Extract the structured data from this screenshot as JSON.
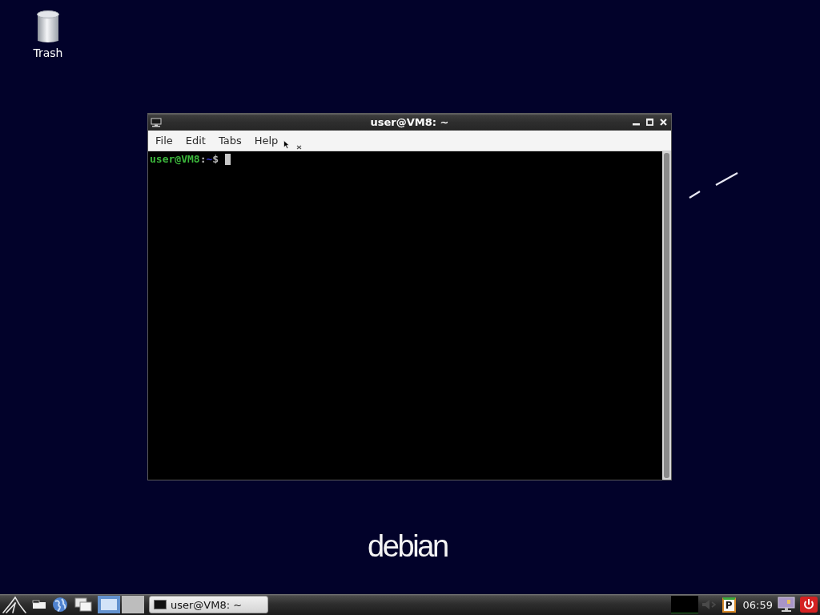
{
  "desktop_icons": [
    {
      "label": "Trash",
      "kind": "trash"
    }
  ],
  "window": {
    "title": "user@VM8: ~",
    "menu": [
      "File",
      "Edit",
      "Tabs",
      "Help"
    ],
    "prompt": [
      {
        "text": "user@VM8",
        "kind": "host"
      },
      {
        "text": ":",
        "kind": "plain"
      },
      {
        "text": "~",
        "kind": "path"
      },
      {
        "text": "$ ",
        "kind": "plain"
      }
    ]
  },
  "wallpaper": {
    "logo": "debian"
  },
  "taskbar": {
    "pager": [
      {
        "selected": true
      },
      {
        "selected": false
      }
    ],
    "tasks": [
      {
        "label": "user@VM8: ~"
      }
    ],
    "applet_letter": "P",
    "clock": "06:59"
  }
}
